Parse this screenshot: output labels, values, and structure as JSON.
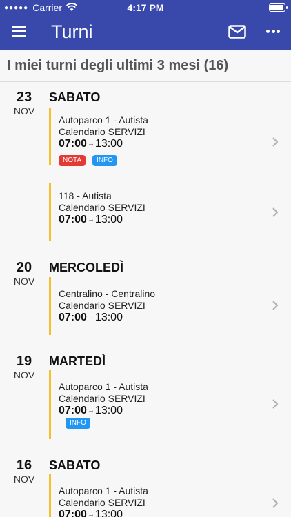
{
  "status_bar": {
    "carrier": "Carrier",
    "time": "4:17 PM",
    "battery_level": 0.95
  },
  "app_bar": {
    "title": "Turni"
  },
  "section": {
    "title": "I miei turni degli ultimi 3 mesi (16)"
  },
  "days": [
    {
      "num": "23",
      "month": "NOV",
      "name": "SABATO",
      "shifts": [
        {
          "place": "Autoparco 1 - Autista",
          "calendar": "Calendario SERVIZI",
          "start": "07:00",
          "arrow": "→",
          "end": "13:00",
          "badges": [
            "NOTA",
            "INFO"
          ]
        },
        {
          "place": "118 - Autista",
          "calendar": "Calendario SERVIZI",
          "start": "07:00",
          "arrow": "→",
          "end": "13:00",
          "badges": []
        }
      ]
    },
    {
      "num": "20",
      "month": "NOV",
      "name": "MERCOLEDÌ",
      "shifts": [
        {
          "place": "Centralino - Centralino",
          "calendar": "Calendario SERVIZI",
          "start": "07:00",
          "arrow": "→",
          "end": "13:00",
          "badges": []
        }
      ]
    },
    {
      "num": "19",
      "month": "NOV",
      "name": "MARTEDÌ",
      "shifts": [
        {
          "place": "Autoparco 1 - Autista",
          "calendar": "Calendario SERVIZI",
          "start": "07:00",
          "arrow": "→",
          "end": "13:00",
          "badges": [
            "INFO"
          ]
        }
      ]
    },
    {
      "num": "16",
      "month": "NOV",
      "name": "SABATO",
      "shifts": [
        {
          "place": "Autoparco 1 - Autista",
          "calendar": "Calendario SERVIZI",
          "start": "07:00",
          "arrow": "→",
          "end": "13:00",
          "badges": []
        }
      ]
    }
  ],
  "colors": {
    "app_bar": "#3949ab",
    "shift_bar": "#f4c02e",
    "nota_badge": "#e53935",
    "info_badge": "#2196f3"
  },
  "icons": {
    "menu": "menu-icon",
    "mail": "mail-icon",
    "more": "more-icon",
    "chevron": "chevron-right-icon"
  }
}
